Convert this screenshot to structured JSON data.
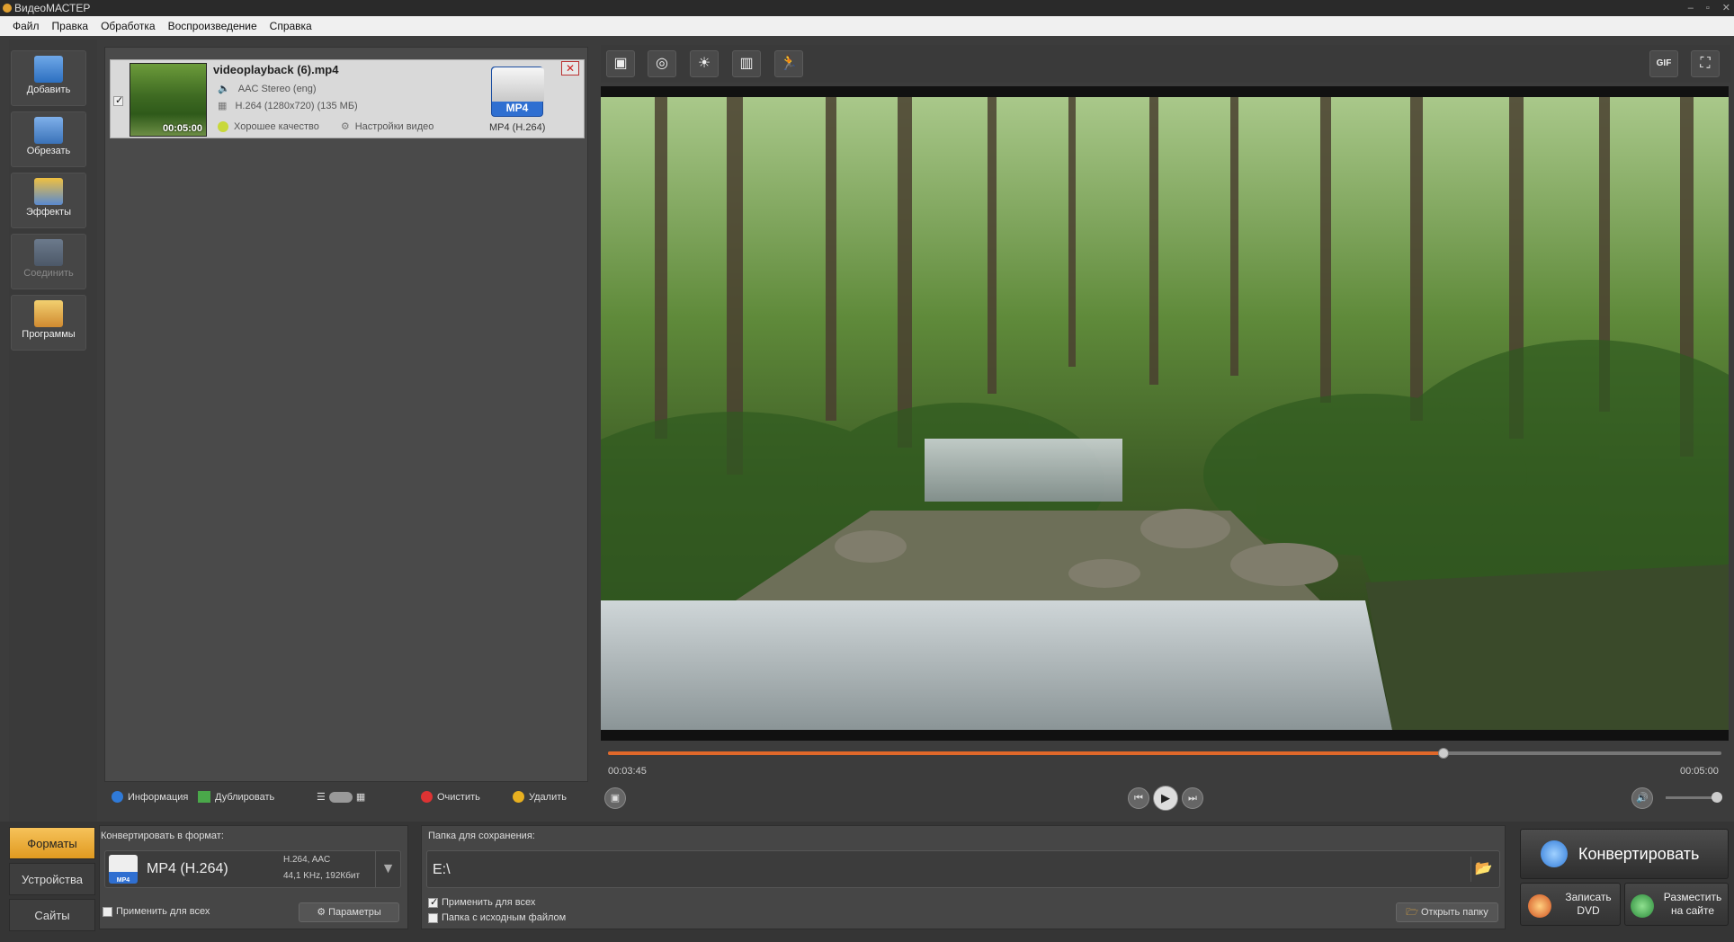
{
  "window": {
    "title": "ВидеоМАСТЕР"
  },
  "menu": [
    "Файл",
    "Правка",
    "Обработка",
    "Воспроизведение",
    "Справка"
  ],
  "left_tools": [
    {
      "label": "Добавить",
      "icon": "add-video-icon",
      "enabled": true
    },
    {
      "label": "Обрезать",
      "icon": "cut-icon",
      "enabled": true
    },
    {
      "label": "Эффекты",
      "icon": "effects-icon",
      "enabled": true
    },
    {
      "label": "Соединить",
      "icon": "join-icon",
      "enabled": false
    },
    {
      "label": "Программы",
      "icon": "programs-icon",
      "enabled": true
    }
  ],
  "file": {
    "name": "videoplayback (6).mp4",
    "audio": "AAC Stereo (eng)",
    "video": "H.264 (1280x720) (135 МБ)",
    "duration": "00:05:00",
    "quality": "Хорошее качество",
    "settings": "Настройки видео",
    "format_badge": "MP4",
    "format_name": "MP4 (H.264)",
    "checked": true
  },
  "file_actions": {
    "info": "Информация",
    "duplicate": "Дублировать",
    "clear": "Очистить",
    "remove": "Удалить"
  },
  "preview_tools": [
    "crop-icon",
    "snapshot-icon",
    "brightness-icon",
    "film-frames-icon",
    "speed-icon"
  ],
  "preview_right_tools": [
    "gif-icon",
    "fullscreen-icon"
  ],
  "gif_label": "GIF",
  "player": {
    "current_time": "00:03:45",
    "total_time": "00:05:00",
    "progress": 0.75,
    "volume": 0.95
  },
  "bottom": {
    "tabs": [
      "Форматы",
      "Устройства",
      "Сайты"
    ],
    "active_tab": 0,
    "format_label": "Конвертировать в формат:",
    "format_name": "MP4 (H.264)",
    "format_badge": "MP4",
    "format_codec": "H.264, AAC",
    "format_audio": "44,1 KHz, 192Кбит",
    "apply_all_format": "Применить для всех",
    "params": "Параметры",
    "folder_label": "Папка для сохранения:",
    "folder_path": "E:\\",
    "apply_all_folder": "Применить для всех",
    "source_folder": "Папка с исходным файлом",
    "open_folder": "Открыть папку",
    "convert": "Конвертировать",
    "burn_dvd_1": "Записать",
    "burn_dvd_2": "DVD",
    "publish_1": "Разместить",
    "publish_2": "на сайте"
  },
  "colors": {
    "accent_orange": "#e0682a",
    "tab_active": "#f0b040",
    "badge_blue": "#2f6fd1"
  }
}
